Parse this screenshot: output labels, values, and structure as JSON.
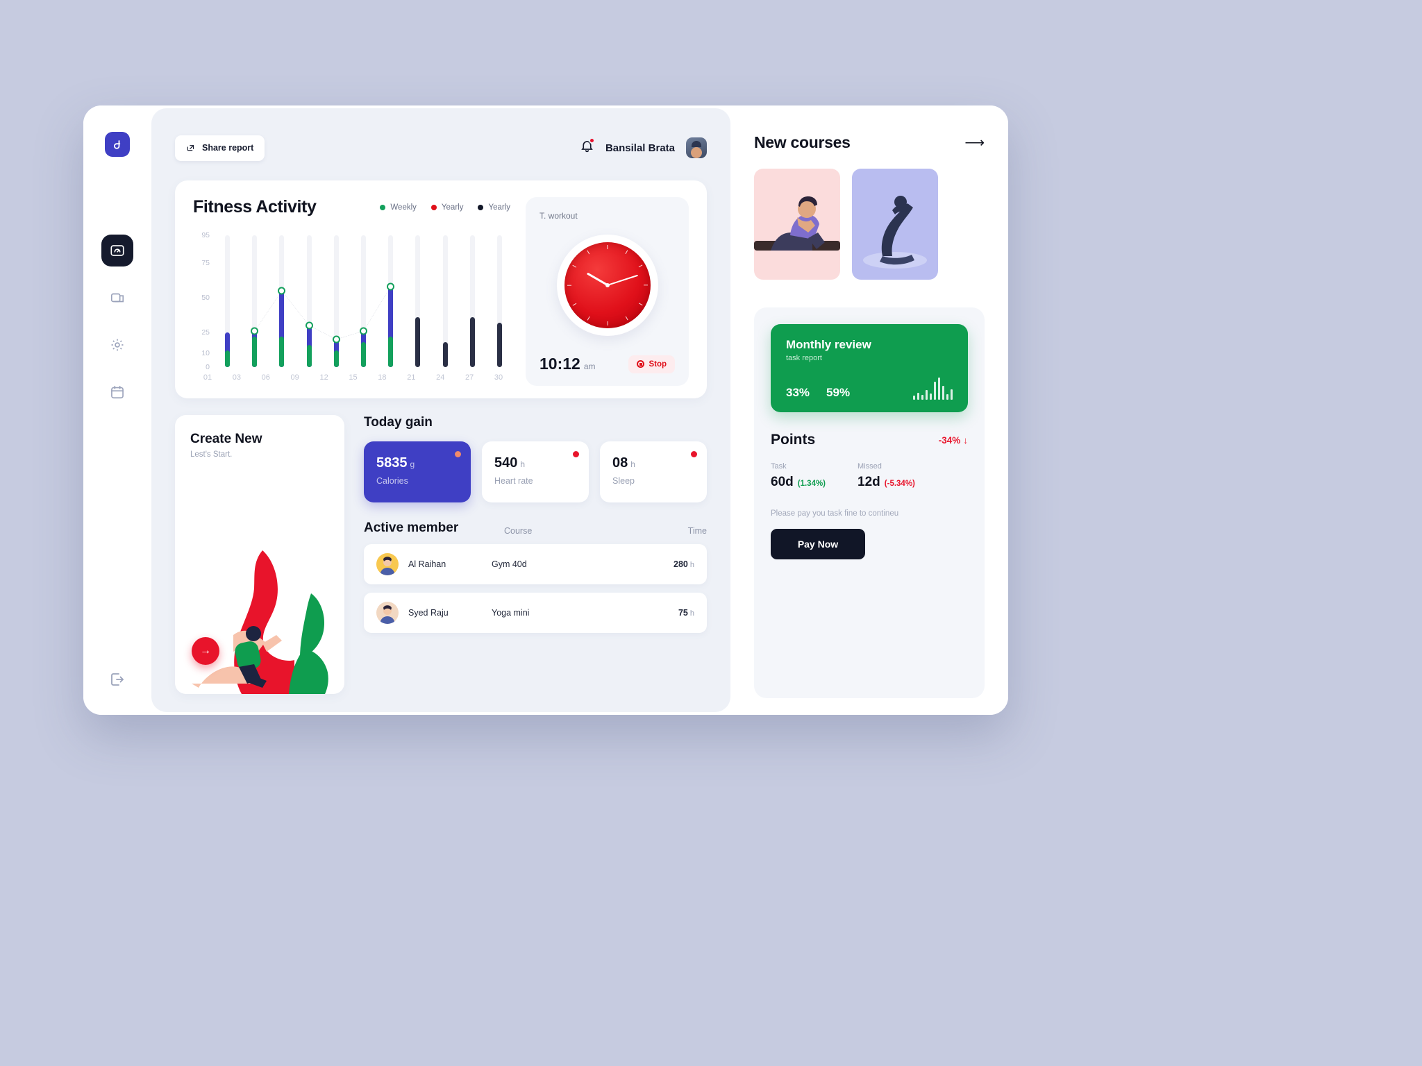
{
  "sidebar": {
    "logo": "logo-mark",
    "items": [
      {
        "name": "dashboard",
        "icon": "speedometer-icon",
        "active": true
      },
      {
        "name": "reports",
        "icon": "chart-card-icon",
        "active": false
      },
      {
        "name": "settings",
        "icon": "gear-icon",
        "active": false
      },
      {
        "name": "calendar",
        "icon": "calendar-icon",
        "active": false
      }
    ],
    "logout_icon": "logout-icon"
  },
  "topbar": {
    "share_label": "Share report",
    "share_icon": "share-icon",
    "bell_icon": "bell-icon",
    "user_name": "Bansilal Brata",
    "avatar": "user-avatar"
  },
  "fitness": {
    "title": "Fitness Activity",
    "legend": [
      {
        "label": "Weekly",
        "color": "#13a05c"
      },
      {
        "label": "Yearly",
        "color": "#e0101a"
      },
      {
        "label": "Yearly",
        "color": "#111627"
      }
    ]
  },
  "chart_data": {
    "type": "bar",
    "title": "Fitness Activity",
    "xlabel": "",
    "ylabel": "",
    "ylim": [
      0,
      95
    ],
    "grid": false,
    "legend_position": "top-right",
    "yticks": [
      "0",
      "10",
      "25",
      "50",
      "75",
      "95"
    ],
    "categories": [
      "01",
      "03",
      "06",
      "09",
      "12",
      "15",
      "18",
      "21",
      "24",
      "27",
      "30"
    ],
    "series": [
      {
        "name": "Weekly",
        "color": "#13a05c",
        "values": [
          12,
          22,
          22,
          16,
          12,
          18,
          22,
          0,
          0,
          0,
          0
        ]
      },
      {
        "name": "Yearly",
        "color": "#3f3fc4",
        "values": [
          25,
          26,
          55,
          30,
          20,
          26,
          58,
          0,
          0,
          0,
          0
        ]
      },
      {
        "name": "Yearly",
        "color": "#2a2f45",
        "values": [
          0,
          0,
          0,
          0,
          0,
          0,
          0,
          36,
          18,
          36,
          32
        ]
      }
    ],
    "markers": {
      "name": "Weekly trend",
      "color": "#13a05c",
      "x": [
        "03",
        "06",
        "09",
        "12",
        "15",
        "18"
      ],
      "values": [
        26,
        55,
        30,
        20,
        26,
        58
      ]
    }
  },
  "workout": {
    "label": "T. workout",
    "clock_icon": "analog-clock",
    "time": "10:12",
    "ampm": "am",
    "stop_label": "Stop",
    "stop_icon": "stop-record-icon"
  },
  "create": {
    "title": "Create New",
    "subtitle": "Lest's Start.",
    "fab_icon": "arrow-right-icon",
    "illustration": "climbing-illustration"
  },
  "today_gain": {
    "title": "Today gain",
    "cards": [
      {
        "value": "5835",
        "unit": "g",
        "label": "Calories",
        "dot": "#f08a6a",
        "primary": true
      },
      {
        "value": "540",
        "unit": "h",
        "label": "Heart rate",
        "dot": "#e8142b",
        "primary": false
      },
      {
        "value": "08",
        "unit": "h",
        "label": "Sleep",
        "dot": "#e8142b",
        "primary": false
      }
    ]
  },
  "active_member": {
    "title": "Active member",
    "columns": [
      "Course",
      "Time"
    ],
    "rows": [
      {
        "name": "Al Raihan",
        "course": "Gym 40d",
        "time": "280",
        "time_unit": "h",
        "avatar_bg": "#f8c84f"
      },
      {
        "name": "Syed Raju",
        "course": "Yoga mini",
        "time": "75",
        "time_unit": "h",
        "avatar_bg": "#f2d8c2"
      }
    ]
  },
  "new_courses": {
    "title": "New courses",
    "arrow_icon": "arrow-right-icon",
    "cards": [
      {
        "name": "sit-up-course",
        "bg": "#fbdcdc"
      },
      {
        "name": "yoga-stretch-course",
        "bg": "#b9bdf0"
      }
    ]
  },
  "monthly_review": {
    "title": "Monthly review",
    "subtitle": "task report",
    "pct_a": "33%",
    "pct_b": "59%",
    "bg": "#0f9d4f",
    "spark": [
      6,
      10,
      7,
      14,
      9,
      26,
      32,
      20,
      8,
      15
    ]
  },
  "points": {
    "title": "Points",
    "delta": "-34%",
    "delta_icon": "arrow-down-icon",
    "delta_color": "#e8142b",
    "stats": [
      {
        "label": "Task",
        "value": "60d",
        "change": "(1.34%)",
        "change_color": "#0f9d4f"
      },
      {
        "label": "Missed",
        "value": "12d",
        "change": "(-5.34%)",
        "change_color": "#e8142b"
      }
    ],
    "note": "Please pay you task fine to contineu",
    "pay_label": "Pay Now"
  }
}
